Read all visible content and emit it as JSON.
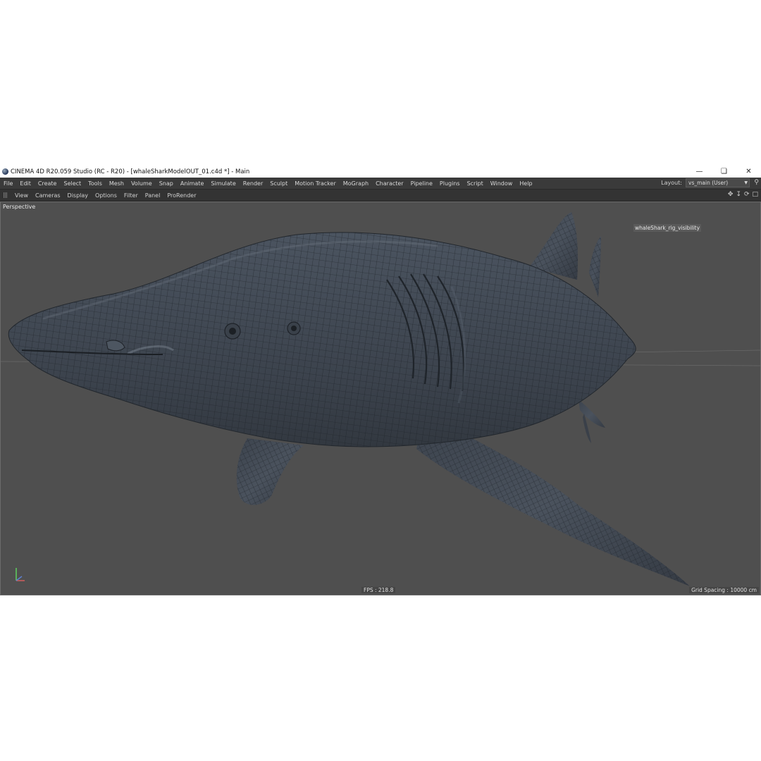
{
  "window": {
    "title": "CINEMA 4D R20.059 Studio (RC - R20) - [whaleSharkModelOUT_01.c4d *] - Main",
    "controls": [
      "minimize",
      "restore",
      "close"
    ]
  },
  "menubar": {
    "items": [
      "File",
      "Edit",
      "Create",
      "Select",
      "Tools",
      "Mesh",
      "Volume",
      "Snap",
      "Animate",
      "Simulate",
      "Render",
      "Sculpt",
      "Motion Tracker",
      "MoGraph",
      "Character",
      "Pipeline",
      "Plugins",
      "Script",
      "Window",
      "Help"
    ],
    "layout_label": "Layout:",
    "layout_value": "vs_main (User)"
  },
  "viewport_menu": {
    "items": [
      "View",
      "Cameras",
      "Display",
      "Options",
      "Filter",
      "Panel",
      "ProRender"
    ]
  },
  "viewport": {
    "name": "Perspective",
    "object_label": "whaleShark_rig_visibility",
    "fps": "FPS : 218.8",
    "grid_spacing": "Grid Spacing : 10000 cm"
  },
  "colors": {
    "viewport_bg": "#4f4f4f",
    "mesh": "#3e4650",
    "wire": "#1e2228"
  }
}
